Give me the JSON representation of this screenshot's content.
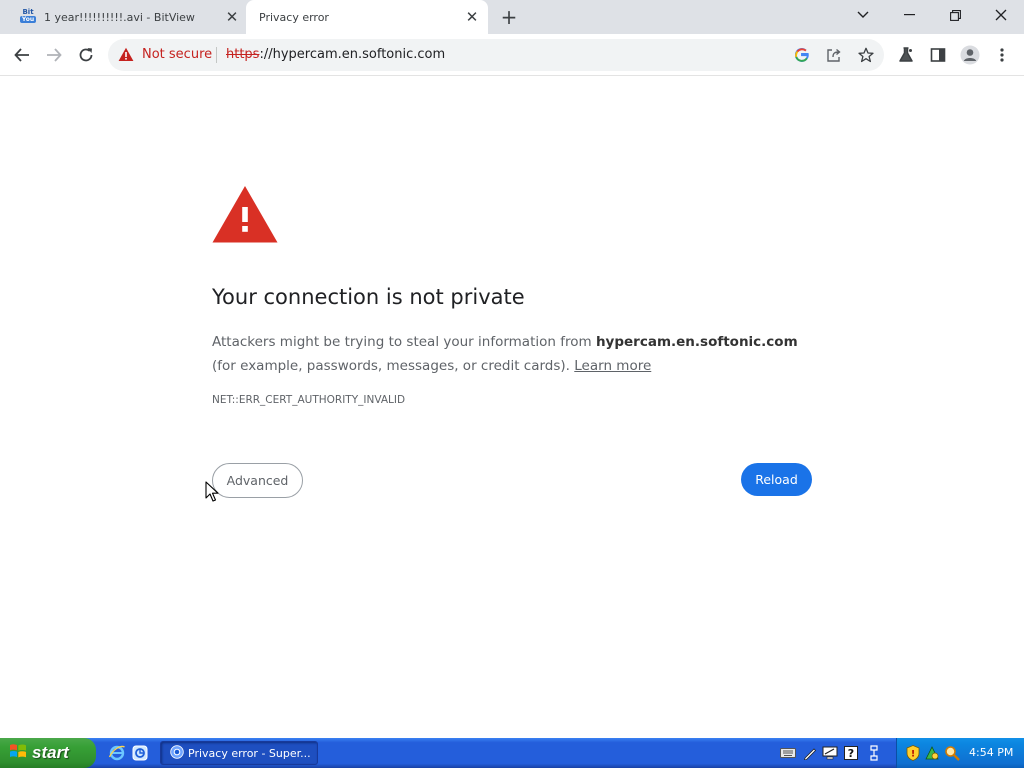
{
  "tabs": [
    {
      "title": "1 year!!!!!!!!!!.avi - BitView",
      "favicon_text": "Bit",
      "favicon_badge": "You"
    },
    {
      "title": "Privacy error"
    }
  ],
  "toolbar": {
    "security_label": "Not secure",
    "url_scheme": "https",
    "url_rest": "://hypercam.en.softonic.com"
  },
  "page": {
    "heading": "Your connection is not private",
    "desc_prefix": "Attackers might be trying to steal your information from ",
    "desc_host": "hypercam.en.softonic.com",
    "desc_suffix": " (for example, passwords, messages, or credit cards). ",
    "learn_more": "Learn more",
    "error_code": "NET::ERR_CERT_AUTHORITY_INVALID",
    "advanced_label": "Advanced",
    "reload_label": "Reload"
  },
  "taskbar": {
    "start_label": "start",
    "task_label": "Privacy error - Super...",
    "clock": "4:54 PM"
  },
  "colors": {
    "error_red": "#d93025",
    "reload_blue": "#1a73e8",
    "taskbar_blue": "#245edb",
    "start_green": "#37a036"
  }
}
